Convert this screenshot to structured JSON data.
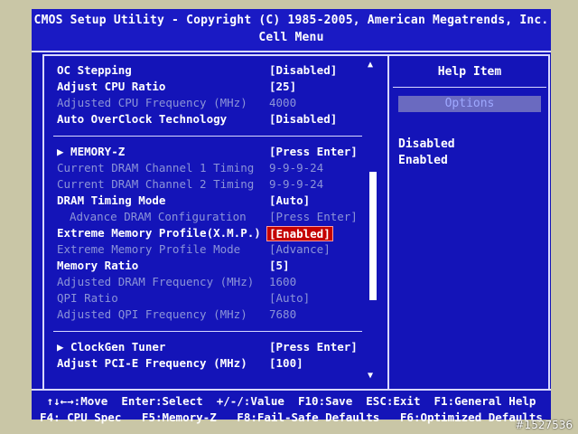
{
  "header": {
    "title": "CMOS Setup Utility - Copyright (C) 1985-2005, American Megatrends, Inc.",
    "menu": "Cell Menu"
  },
  "settings": [
    {
      "label": "OC Stepping",
      "value": "[Disabled]",
      "state": "normal"
    },
    {
      "label": "Adjust CPU Ratio",
      "value": "[25]",
      "state": "normal"
    },
    {
      "label": "Adjusted CPU Frequency (MHz)",
      "value": "4000",
      "state": "dim"
    },
    {
      "label": "Auto OverClock Technology",
      "value": "[Disabled]",
      "state": "normal"
    },
    {
      "label": "▶ MEMORY-Z",
      "value": "[Press Enter]",
      "state": "normal"
    },
    {
      "label": "Current DRAM Channel 1 Timing",
      "value": "9-9-9-24",
      "state": "dim"
    },
    {
      "label": "Current DRAM Channel 2 Timing",
      "value": "9-9-9-24",
      "state": "dim"
    },
    {
      "label": "DRAM Timing Mode",
      "value": "[Auto]",
      "state": "normal"
    },
    {
      "label": "Advance DRAM Configuration",
      "value": "[Press Enter]",
      "state": "dim-sub"
    },
    {
      "label": "Extreme Memory Profile(X.M.P.)",
      "value": "[Enabled]",
      "state": "selected"
    },
    {
      "label": "Extreme Memory Profile Mode",
      "value": "[Advance]",
      "state": "dim"
    },
    {
      "label": "Memory Ratio",
      "value": "[5]",
      "state": "normal"
    },
    {
      "label": "Adjusted DRAM Frequency (MHz)",
      "value": "1600",
      "state": "dim"
    },
    {
      "label": "QPI Ratio",
      "value": "[Auto]",
      "state": "dim"
    },
    {
      "label": "Adjusted QPI Frequency (MHz)",
      "value": "7680",
      "state": "dim"
    },
    {
      "label": "▶ ClockGen Tuner",
      "value": "[Press Enter]",
      "state": "normal"
    },
    {
      "label": "Adjust PCI-E Frequency (MHz)",
      "value": "[100]",
      "state": "normal"
    }
  ],
  "help": {
    "title": "Help Item",
    "options_label": "Options",
    "options": [
      "Disabled",
      "Enabled"
    ]
  },
  "footer": {
    "line1": "↑↓←→:Move  Enter:Select  +/-/:Value  F10:Save  ESC:Exit  F1:General Help",
    "line2": "F4: CPU Spec   F5:Memory-Z   F8:Fail-Safe Defaults   F6:Optimized Defaults"
  },
  "watermark": "#1527536",
  "colors": {
    "background": "#1414b8",
    "text": "#ffffff",
    "dim_text": "#8c94d8",
    "selected_bg": "#c40000",
    "bezel": "#c9c6a6"
  }
}
